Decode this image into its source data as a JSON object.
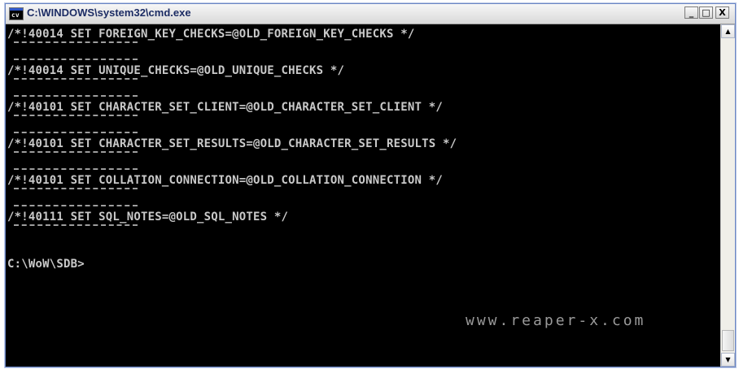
{
  "window": {
    "title": "C:\\WINDOWS\\system32\\cmd.exe",
    "minimize_glyph": "_",
    "maximize_glyph": "□",
    "close_glyph": "X",
    "app_icon_label": "cv"
  },
  "console": {
    "lines": [
      "/*!40014 SET FOREIGN_KEY_CHECKS=@OLD_FOREIGN_KEY_CHECKS */",
      "/*!40014 SET UNIQUE_CHECKS=@OLD_UNIQUE_CHECKS */",
      "/*!40101 SET CHARACTER_SET_CLIENT=@OLD_CHARACTER_SET_CLIENT */",
      "/*!40101 SET CHARACTER_SET_RESULTS=@OLD_CHARACTER_SET_RESULTS */",
      "/*!40101 SET COLLATION_CONNECTION=@OLD_COLLATION_CONNECTION */",
      "/*!40111 SET SQL_NOTES=@OLD_SQL_NOTES */"
    ],
    "prompt": "C:\\WoW\\SDB>"
  },
  "watermark": "www.reaper-x.com",
  "scrollbar": {
    "up_glyph": "▲",
    "down_glyph": "▼"
  }
}
